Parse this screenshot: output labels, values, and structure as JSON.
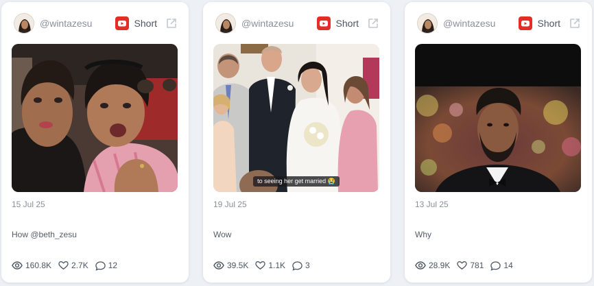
{
  "cards": [
    {
      "username": "@wintazesu",
      "platform_label": "Short",
      "platform_icon": "youtube-icon",
      "caption": "",
      "date": "15 Jul 25",
      "title": "How @beth_zesu",
      "views": "160.8K",
      "likes": "2.7K",
      "comments": "12"
    },
    {
      "username": "@wintazesu",
      "platform_label": "Short",
      "platform_icon": "youtube-icon",
      "caption": "to seeing her get married 😭",
      "date": "19 Jul 25",
      "title": "Wow",
      "views": "39.5K",
      "likes": "1.1K",
      "comments": "3"
    },
    {
      "username": "@wintazesu",
      "platform_label": "Short",
      "platform_icon": "youtube-icon",
      "caption": "",
      "date": "13 Jul 25",
      "title": "Why",
      "views": "28.9K",
      "likes": "781",
      "comments": "14"
    }
  ],
  "colors": {
    "background": "#edf0f5",
    "card": "#ffffff",
    "youtube_red": "#e52d27",
    "muted_text": "#8a8f9c"
  }
}
